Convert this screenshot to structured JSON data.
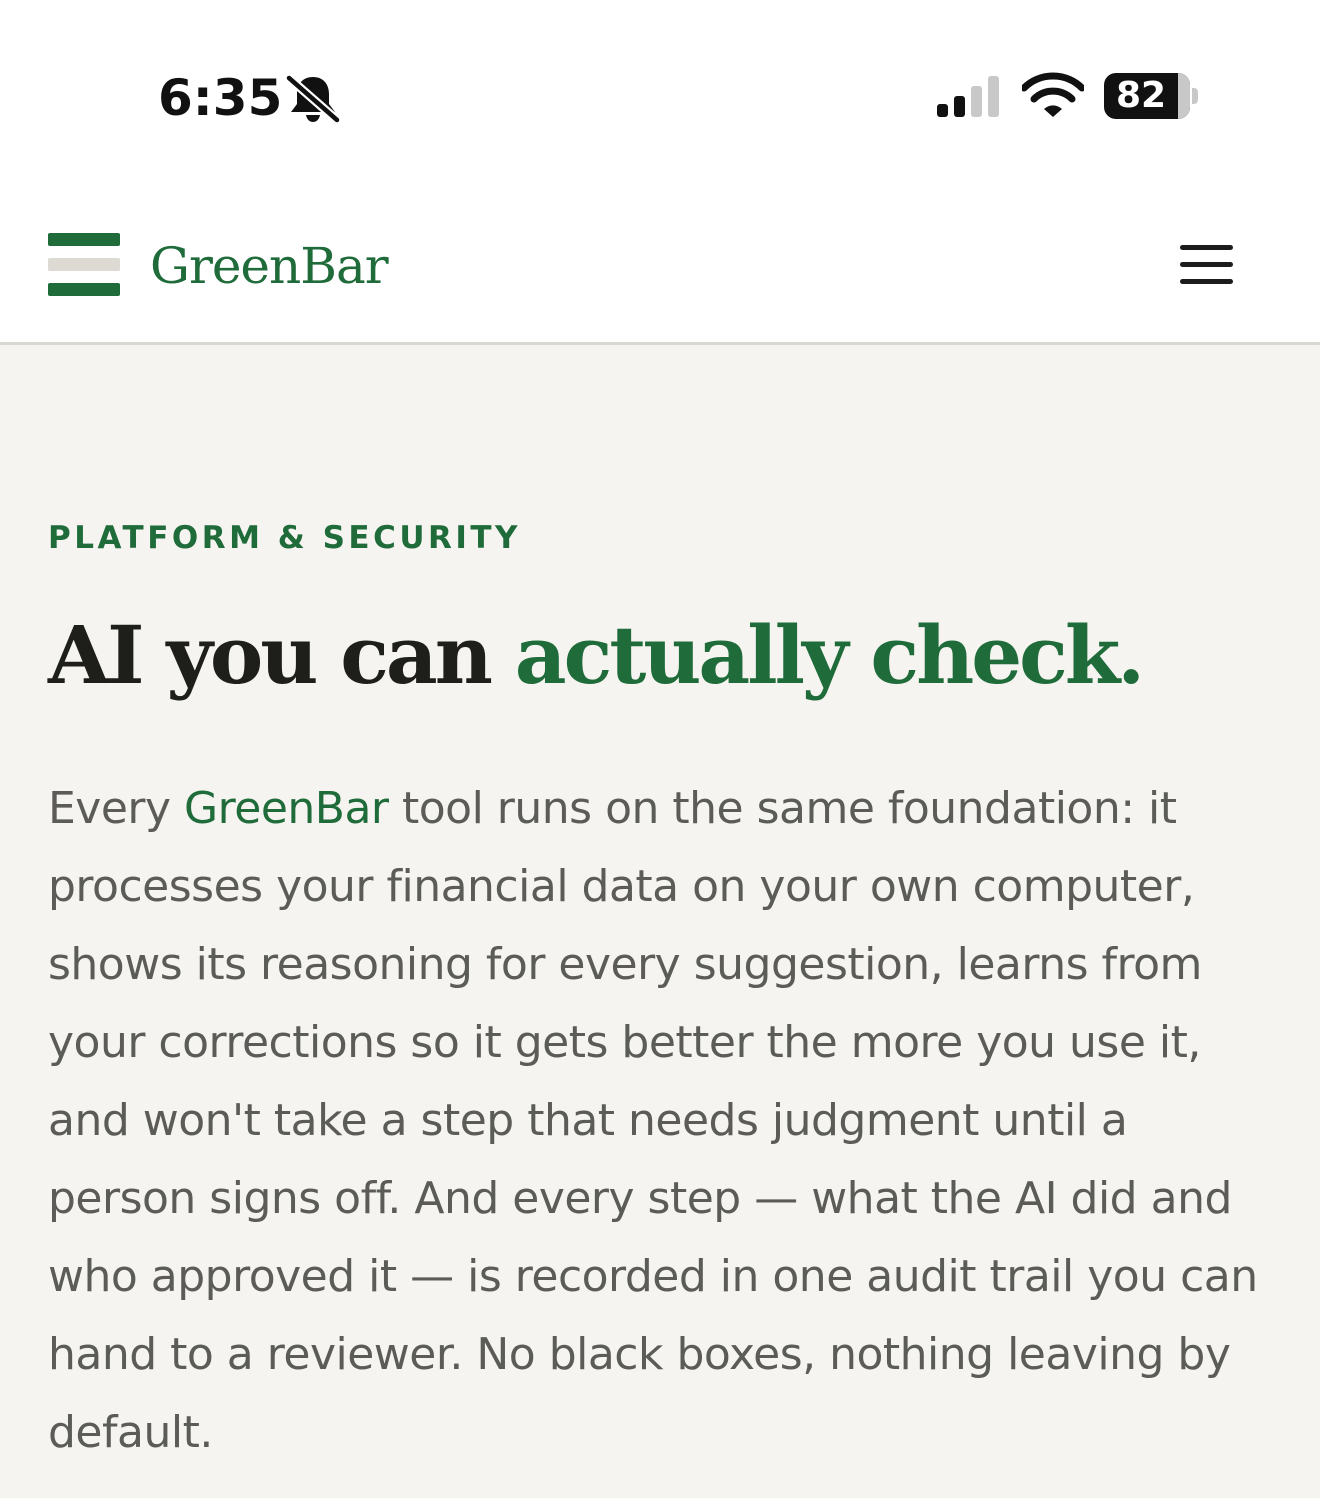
{
  "status_bar": {
    "time": "6:35",
    "battery_level": "82",
    "icons": [
      "bell-slash-icon",
      "cellular-signal-icon",
      "wifi-icon",
      "battery-icon"
    ]
  },
  "header": {
    "brand_name": "GreenBar",
    "logo_icon": "greenbar-logo-icon",
    "menu_icon": "hamburger-menu-icon"
  },
  "hero": {
    "eyebrow": "PLATFORM & SECURITY",
    "headline_part1": "AI you can ",
    "headline_accent": "actually check.",
    "body_part1": "Every ",
    "body_brand": "GreenBar",
    "body_part2": " tool runs on the same foundation: it processes your financial data on your own computer, shows its reasoning for every suggestion, learns from your corrections so it gets better the more you use it, and won't take a step that needs judgment until a person signs off. And every step — what the AI did and who approved it — is recorded in one audit trail you can hand to a reviewer. No black boxes, nothing leaving by default."
  },
  "colors": {
    "brand_green": "#1f6b3a",
    "page_background": "#f5f4f0",
    "header_background": "#ffffff",
    "headline_text": "#1e1e1b",
    "body_text": "#5b5b57"
  }
}
